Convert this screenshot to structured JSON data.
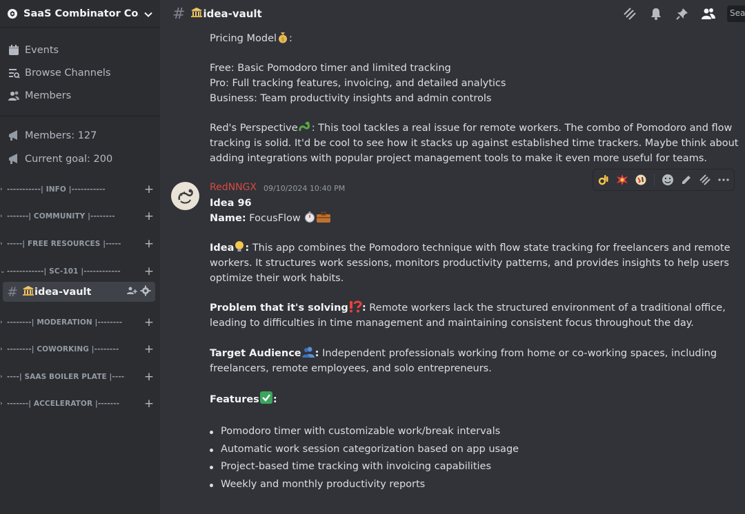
{
  "server": {
    "name": "SaaS Combinator Co..."
  },
  "sidebar": {
    "nav": [
      {
        "label": "Events",
        "icon": "calendar-icon"
      },
      {
        "label": "Browse Channels",
        "icon": "browse-channels-icon"
      },
      {
        "label": "Members",
        "icon": "members-icon"
      }
    ],
    "stats": [
      {
        "label": "Members: 127",
        "icon": "megaphone-icon"
      },
      {
        "label": "Current goal: 200",
        "icon": "megaphone-icon"
      }
    ],
    "categories": [
      "-----------| INFO |-----------",
      "-------| COMMUNITY |--------",
      "-----| FREE RESOURCES |-----",
      "------------| SC-101 |------------",
      "--------| MODERATION |--------",
      "--------| COWORKING |--------",
      "----| SAAS BOILER PLATE |----",
      "-------| ACCELERATOR |-------"
    ],
    "active_channel": "idea-vault"
  },
  "header": {
    "channel": "idea-vault",
    "search_placeholder": "Sea"
  },
  "prev_message": {
    "pricing_heading": "Pricing Model",
    "pricing": [
      "Free: Basic Pomodoro timer and limited tracking",
      "Pro: Full tracking features, invoicing, and detailed analytics",
      "Business: Team productivity insights and admin controls"
    ],
    "perspective_label": "Red's Perspective",
    "perspective_lines": [
      ": This tool tackles a real issue for remote workers. The combo of Pomodoro and flow",
      "tracking is solid. It'd be cool to see how it stacks up against established time trackers. Maybe think about",
      "adding integrations with popular project management tools to make it even more useful for teams."
    ]
  },
  "message": {
    "author": "RedNNGX",
    "timestamp": "09/10/2024 10:40 PM",
    "idea_number": "Idea 96",
    "name_label": "Name:",
    "name_value": "FocusFlow",
    "idea_label": "Idea",
    "idea_lines": [
      "This app combines the Pomodoro technique with flow state tracking for freelancers and remote",
      "workers. It structures work sessions, monitors productivity patterns, and provides insights to help users",
      "optimize their work habits."
    ],
    "problem_label": "Problem that it's solving",
    "problem_lines": [
      "Remote workers lack the structured environment of a traditional office,",
      "leading to difficulties in time management and maintaining consistent focus throughout the day."
    ],
    "audience_label": "Target Audience",
    "audience_lines": [
      "Independent professionals working from home or co-working spaces, including",
      "freelancers, remote employees, and solo entrepreneurs."
    ],
    "features_label": "Features",
    "features": [
      "Pomodoro timer with customizable work/break intervals",
      "Automatic work session categorization based on app usage",
      "Project-based time tracking with invoicing capabilities",
      "Weekly and monthly productivity reports"
    ]
  },
  "colors": {
    "sidebar": "#2b2d31",
    "chat": "#313338",
    "author": "#d84a3f",
    "active": "#404249"
  }
}
